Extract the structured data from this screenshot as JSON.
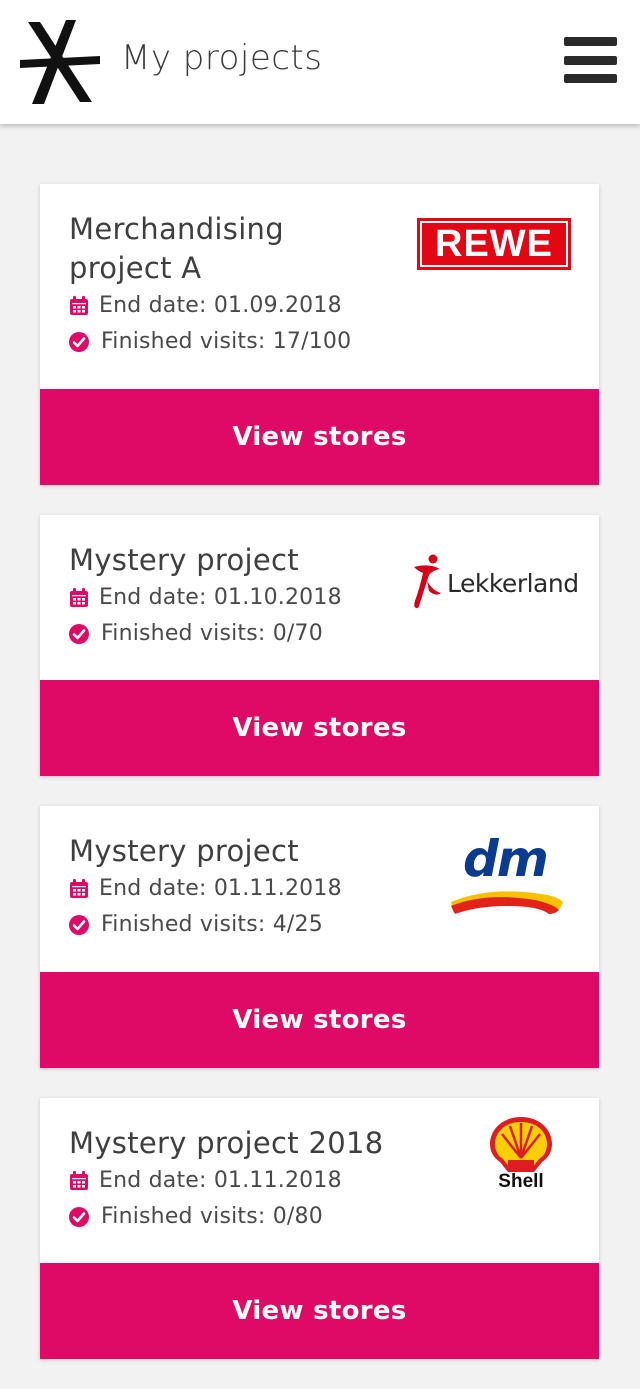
{
  "header": {
    "title": "My projects",
    "logo_icon": "asterisk-logo-icon",
    "menu_icon": "hamburger-menu-icon"
  },
  "colors": {
    "accent": "#df0a66",
    "rewe_red": "#e30613",
    "dm_blue": "#0a3b8f",
    "shell_yellow": "#fbce07",
    "shell_red": "#dd1d21"
  },
  "projects": [
    {
      "title": "Merchandising project A",
      "end_date": "End date: 01.09.2018",
      "visits": "Finished visits: 17/100",
      "brand": "REWE",
      "button": "View stores"
    },
    {
      "title": "Mystery project",
      "end_date": "End date: 01.10.2018",
      "visits": "Finished visits: 0/70",
      "brand": "Lekkerland",
      "button": "View stores"
    },
    {
      "title": "Mystery project",
      "end_date": "End date: 01.11.2018",
      "visits": "Finished visits: 4/25",
      "brand": "dm",
      "button": "View stores"
    },
    {
      "title": "Mystery project 2018",
      "end_date": "End date: 01.11.2018",
      "visits": "Finished visits: 0/80",
      "brand": "Shell",
      "button": "View stores"
    }
  ]
}
